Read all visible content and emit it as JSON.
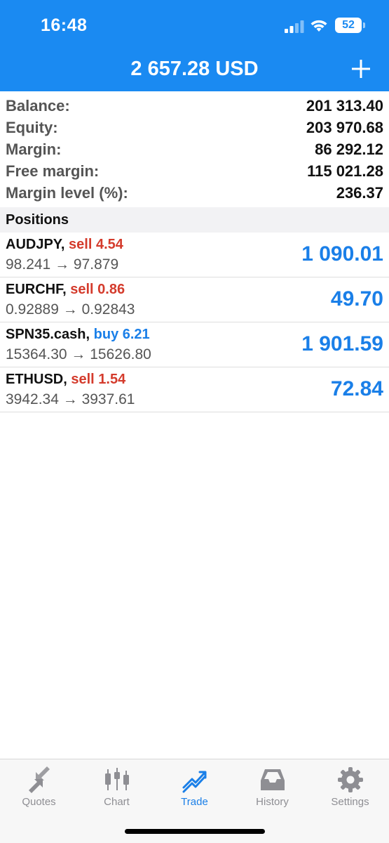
{
  "status_bar": {
    "time": "16:48",
    "battery": "52"
  },
  "header": {
    "title": "2 657.28 USD",
    "add_label": "+"
  },
  "summary": [
    {
      "label": "Balance:",
      "value": "201 313.40"
    },
    {
      "label": "Equity:",
      "value": "203 970.68"
    },
    {
      "label": "Margin:",
      "value": "86 292.12"
    },
    {
      "label": "Free margin:",
      "value": "115 021.28"
    },
    {
      "label": "Margin level (%):",
      "value": "236.37"
    }
  ],
  "positions_title": "Positions",
  "positions": [
    {
      "symbol": "AUDJPY,",
      "direction": "sell 4.54",
      "side": "sell",
      "prices": "98.241 → 97.879",
      "profit": "1 090.01"
    },
    {
      "symbol": "EURCHF,",
      "direction": "sell 0.86",
      "side": "sell",
      "prices": "0.92889 → 0.92843",
      "profit": "49.70"
    },
    {
      "symbol": "SPN35.cash,",
      "direction": "buy 6.21",
      "side": "buy",
      "prices": "15364.30 → 15626.80",
      "profit": "1 901.59"
    },
    {
      "symbol": "ETHUSD,",
      "direction": "sell 1.54",
      "side": "sell",
      "prices": "3942.34 → 3937.61",
      "profit": "72.84"
    }
  ],
  "tabs": [
    {
      "label": "Quotes",
      "icon": "quotes-arrows-icon"
    },
    {
      "label": "Chart",
      "icon": "candlestick-icon"
    },
    {
      "label": "Trade",
      "icon": "trend-up-icon",
      "active": true
    },
    {
      "label": "History",
      "icon": "inbox-tray-icon"
    },
    {
      "label": "Settings",
      "icon": "gear-icon"
    }
  ],
  "colors": {
    "header_blue": "#1a8af2",
    "sell_red": "#d43b2c",
    "profit_blue": "#1a7fe8",
    "tab_inactive": "#8e8e93"
  }
}
